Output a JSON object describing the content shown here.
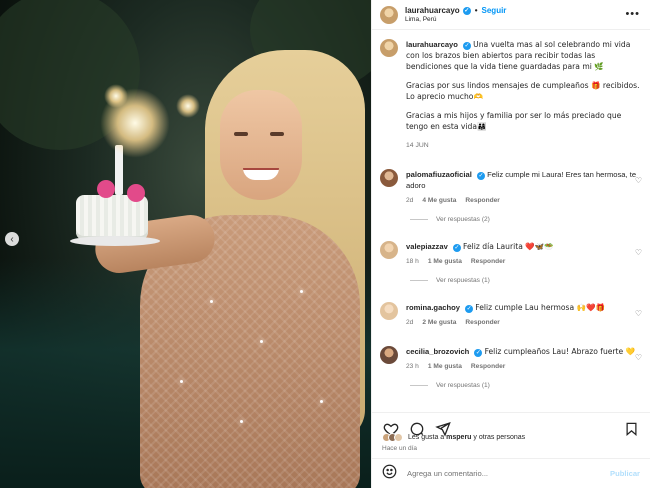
{
  "post": {
    "username": "laurahuarcayo",
    "location": "Lima, Perú",
    "follow_label": "Seguir",
    "more_label": "•••",
    "caption_paragraphs": [
      "Una vuelta mas al sol celebrando mi vida con los brazos bien abiertos para recibir todas las bendiciones que la vida tiene guardadas para mi 🌿",
      "Gracias por sus lindos mensajes de cumpleaños 🎁 recibidos. Lo aprecio mucho🫶",
      "Gracias a mis hijos y familia por ser lo más preciado que tengo en esta vida👨‍👩‍👧"
    ],
    "caption_date": "14 JUN"
  },
  "comments": [
    {
      "username": "palomafiuzaoficial",
      "text": "Feliz cumple mi Laura! Eres tan hermosa, te adoro",
      "time": "2d",
      "likes": "4 Me gusta",
      "reply": "Responder",
      "replies": "Ver respuestas (2)",
      "avatar_color": "#8a5a3c"
    },
    {
      "username": "valepiazzav",
      "text": "Feliz día Laurita ❤️🦋🥗",
      "time": "18 h",
      "likes": "1 Me gusta",
      "reply": "Responder",
      "replies": "Ver respuestas (1)",
      "avatar_color": "#d7b48a"
    },
    {
      "username": "romina.gachoy",
      "text": "Feliz cumple Lau hermosa 🙌❤️🎁",
      "time": "2d",
      "likes": "2 Me gusta",
      "reply": "Responder",
      "replies": "",
      "avatar_color": "#e3c49e"
    },
    {
      "username": "cecilia_brozovich",
      "text": "Feliz cumpleaños Lau! Abrazo fuerte 💛",
      "time": "23 h",
      "likes": "1 Me gusta",
      "reply": "Responder",
      "replies": "Ver respuestas (1)",
      "avatar_color": "#6b4a3a"
    }
  ],
  "likes_summary": {
    "prefix": "Les gusta a",
    "user": "msperu",
    "suffix": "y otras personas",
    "ago": "Hace un día"
  },
  "add_comment": {
    "placeholder": "Agrega un comentario...",
    "publish": "Publicar"
  },
  "colors": {
    "accent": "#0095f6",
    "verified": "#1d9bf0",
    "muted": "#737373"
  },
  "icons": [
    "carousel-prev-icon",
    "more-icon",
    "verified-icon",
    "heart-icon",
    "comment-icon",
    "share-icon",
    "bookmark-icon",
    "emoji-icon"
  ]
}
